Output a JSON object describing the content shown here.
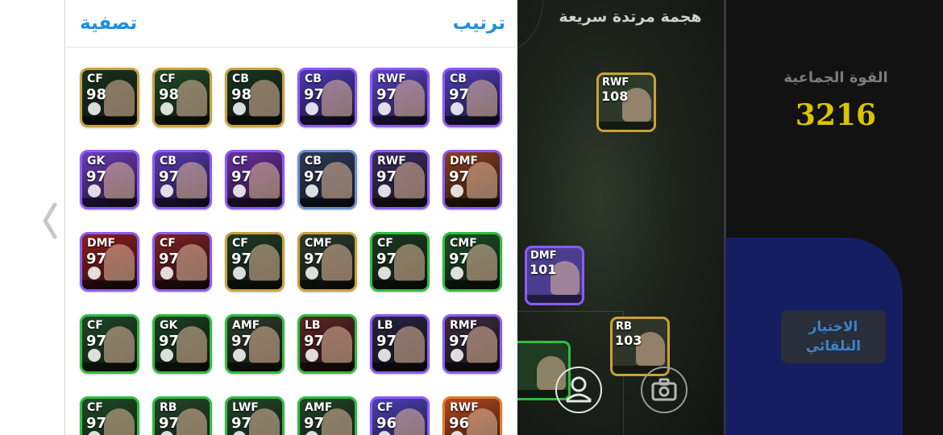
{
  "filter_panel": {
    "filter_label": "تصفية",
    "sort_label": "ترتيب",
    "back_icon": "chevron-left-icon"
  },
  "players": [
    {
      "pos": "CF",
      "rating": "98",
      "border": "#c9a23a",
      "bg": "#18331e"
    },
    {
      "pos": "CF",
      "rating": "98",
      "border": "#c9a23a",
      "bg": "#1f4a25"
    },
    {
      "pos": "CB",
      "rating": "98",
      "border": "#c9a23a",
      "bg": "#173522"
    },
    {
      "pos": "CB",
      "rating": "97",
      "border": "#8b5cf6",
      "bg": "#4c39b8"
    },
    {
      "pos": "RWF",
      "rating": "97",
      "border": "#8b5cf6",
      "bg": "#5b41c8"
    },
    {
      "pos": "CB",
      "rating": "97",
      "border": "#8b5cf6",
      "bg": "#4e3db9"
    },
    {
      "pos": "GK",
      "rating": "97",
      "border": "#8b5cf6",
      "bg": "#6d3bb8"
    },
    {
      "pos": "CB",
      "rating": "97",
      "border": "#8b5cf6",
      "bg": "#5a3bb3"
    },
    {
      "pos": "CF",
      "rating": "97",
      "border": "#8b5cf6",
      "bg": "#6a2f9e"
    },
    {
      "pos": "CB",
      "rating": "97",
      "border": "#6b8fd1",
      "bg": "#2d3b58"
    },
    {
      "pos": "RWF",
      "rating": "97",
      "border": "#8b5cf6",
      "bg": "#3b2b5e"
    },
    {
      "pos": "DMF",
      "rating": "97",
      "border": "#8b5cf6",
      "bg": "#8a3d1c"
    },
    {
      "pos": "DMF",
      "rating": "97",
      "border": "#8b5cf6",
      "bg": "#8e1d1d"
    },
    {
      "pos": "CF",
      "rating": "97",
      "border": "#8b5cf6",
      "bg": "#7e2020"
    },
    {
      "pos": "CF",
      "rating": "97",
      "border": "#c9a23a",
      "bg": "#1e3b24"
    },
    {
      "pos": "CMF",
      "rating": "97",
      "border": "#c9a23a",
      "bg": "#2b3b2a"
    },
    {
      "pos": "CF",
      "rating": "97",
      "border": "#2fbd3f",
      "bg": "#1a3b1f"
    },
    {
      "pos": "CMF",
      "rating": "97",
      "border": "#2fbd3f",
      "bg": "#1e4d26"
    },
    {
      "pos": "CF",
      "rating": "97",
      "border": "#2fbd3f",
      "bg": "#204728"
    },
    {
      "pos": "GK",
      "rating": "97",
      "border": "#2fbd3f",
      "bg": "#1b3f22"
    },
    {
      "pos": "AMF",
      "rating": "97",
      "border": "#2fbd3f",
      "bg": "#2c3d2a"
    },
    {
      "pos": "LB",
      "rating": "97",
      "border": "#2fbd3f",
      "bg": "#5e2424"
    },
    {
      "pos": "LB",
      "rating": "97",
      "border": "#8b5cf6",
      "bg": "#27243f"
    },
    {
      "pos": "RMF",
      "rating": "97",
      "border": "#8b5cf6",
      "bg": "#3c2b3f"
    },
    {
      "pos": "CF",
      "rating": "97",
      "border": "#2fbd3f",
      "bg": "#1e4a26"
    },
    {
      "pos": "RB",
      "rating": "97",
      "border": "#2fbd3f",
      "bg": "#24462a"
    },
    {
      "pos": "LWF",
      "rating": "97",
      "border": "#2fbd3f",
      "bg": "#23452a"
    },
    {
      "pos": "AMF",
      "rating": "97",
      "border": "#2fbd3f",
      "bg": "#22442a"
    },
    {
      "pos": "CF",
      "rating": "96",
      "border": "#8b5cf6",
      "bg": "#4d3fb6"
    },
    {
      "pos": "RWF",
      "rating": "96",
      "border": "#e07a2a",
      "bg": "#b3471c"
    }
  ],
  "squad": {
    "formation_label": "هجمة مرتدة سريعة",
    "team_strength_label": "القوة الجماعية",
    "team_strength_value": "3216",
    "auto_select_line1": "الاختيار",
    "auto_select_line2": "التلقائي",
    "pitch_players": [
      {
        "pos": "RWF",
        "rating": "108"
      },
      {
        "pos": "DMF",
        "rating": "101"
      },
      {
        "pos": "RB",
        "rating": "103"
      }
    ],
    "profile_icon": "person-icon",
    "camera_icon": "camera-icon"
  }
}
